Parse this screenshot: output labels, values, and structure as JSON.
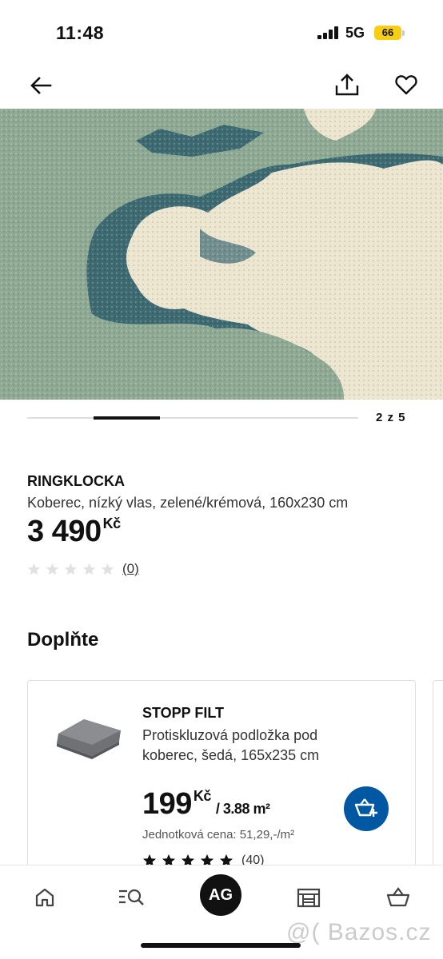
{
  "status_bar": {
    "time": "11:48",
    "network": "5G",
    "battery": "66"
  },
  "top_nav": {
    "icons": [
      "arrow-left-icon",
      "share-icon",
      "heart-icon"
    ]
  },
  "gallery": {
    "counter": "2 z 5",
    "current_index": 2,
    "total": 5
  },
  "product": {
    "name": "RINGKLOCKA",
    "description": "Koberec, nízký vlas, zelené/krémová, 160x230 cm",
    "price": "3 490",
    "currency": "Kč",
    "rating_value": 0,
    "rating_count": "(0)"
  },
  "complement": {
    "title": "Doplňte",
    "card": {
      "name": "STOPP FILT",
      "description": "Protiskluzová podložka pod koberec, šedá, 165x235 cm",
      "price": "199",
      "currency": "Kč",
      "unit": "/ 3.88 m²",
      "unit_price": "Jednotková cena: 51,29,-/m²",
      "rating_value": 5,
      "rating_count": "(40)",
      "add_icon": "add-to-cart-icon"
    }
  },
  "bottom_nav": {
    "items": [
      "home-icon",
      "search-icon",
      "avatar",
      "store-icon",
      "cart-icon"
    ],
    "avatar_initials": "AG"
  },
  "watermark": "@( Bazos.cz",
  "colors": {
    "accent": "#0058a3",
    "star_empty": "#e1e1e1",
    "star_filled": "#111111",
    "battery": "#f7ce16"
  }
}
